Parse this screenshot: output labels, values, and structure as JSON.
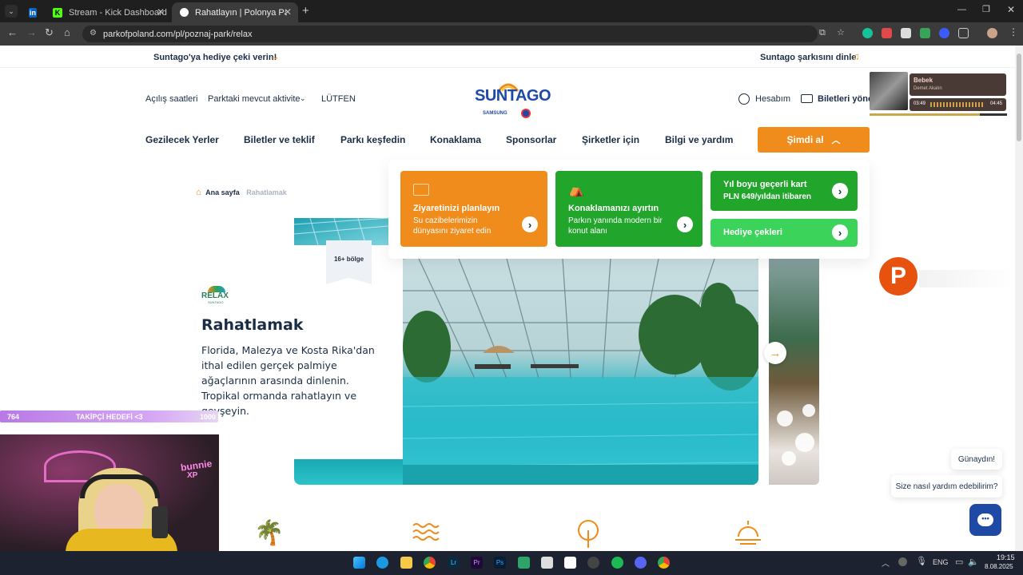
{
  "browser": {
    "tabs": [
      {
        "label": "",
        "icon": "linkedin-icon"
      },
      {
        "label": "Stream - Kick Dashboard",
        "icon": "kick-icon"
      },
      {
        "label": "Rahatlayın | Polonya Parkı - Sun",
        "icon": "suntago-icon"
      }
    ],
    "url": "parkofpoland.com/pl/poznaj-park/relax"
  },
  "promo": {
    "left": "Suntago'ya hediye çeki verin!",
    "right": "Suntago şarkısını dinle"
  },
  "header": {
    "hours": "Açılış saatleri",
    "activities": "Parktaki mevcut aktivite",
    "please": "LÜTFEN",
    "logo": "SUNTAGO",
    "logo_sub": "SAMSUNG",
    "account": "Hesabım",
    "tickets": "Biletleri yönet"
  },
  "mainnav": {
    "items": [
      "Gezilecek Yerler",
      "Biletler ve teklif",
      "Parkı keşfedin",
      "Konaklama",
      "Sponsorlar",
      "Şirketler için",
      "Bilgi ve yardım"
    ],
    "cta": "Şimdi al"
  },
  "dropdown": {
    "plan_title": "Ziyaretinizi planlayın",
    "plan_sub1": "Su cazibelerimizin",
    "plan_sub2": "dünyasını ziyaret edin",
    "stay_title": "Konaklamanızı ayırtın",
    "stay_sub1": "Parkın yanında modern bir",
    "stay_sub2": "konut alanı",
    "year_title": "Yıl boyu geçerli kart",
    "year_sub": "PLN 649/yıldan itibaren",
    "gift": "Hediye çekleri"
  },
  "breadcrumb": {
    "home": "Ana sayfa",
    "current": "Rahatlamak"
  },
  "zone": {
    "badge": "16+ bölge",
    "logo": "RELAX",
    "logo_sub": "SUNTAGO",
    "title": "Rahatlamak",
    "description": "Florida, Malezya ve Kosta Rika'dan ithal edilen gerçek palmiye ağaçlarının arasında dinlenin. Tropikal ormanda rahatlayın ve gevşeyin."
  },
  "stream": {
    "goal_current": "764",
    "goal_label": "TAKİPÇİ HEDEFİ <3",
    "goal_target": "1000",
    "cam_text1": "bunnie",
    "cam_text2": "XP"
  },
  "spotify": {
    "title": "Bebek",
    "artist": "Demet Akalın",
    "elapsed": "03:49",
    "total": "04:45"
  },
  "chat": {
    "greeting": "Günaydın!",
    "question": "Size nasıl yardım edebilirim?"
  },
  "taskbar": {
    "lang": "ENG",
    "time": "19:15",
    "date": "8.08.2025"
  },
  "colors": {
    "orange": "#f08c1b",
    "green": "#21a52b",
    "navy": "#1b2d45",
    "pool": "#29bfd2"
  }
}
